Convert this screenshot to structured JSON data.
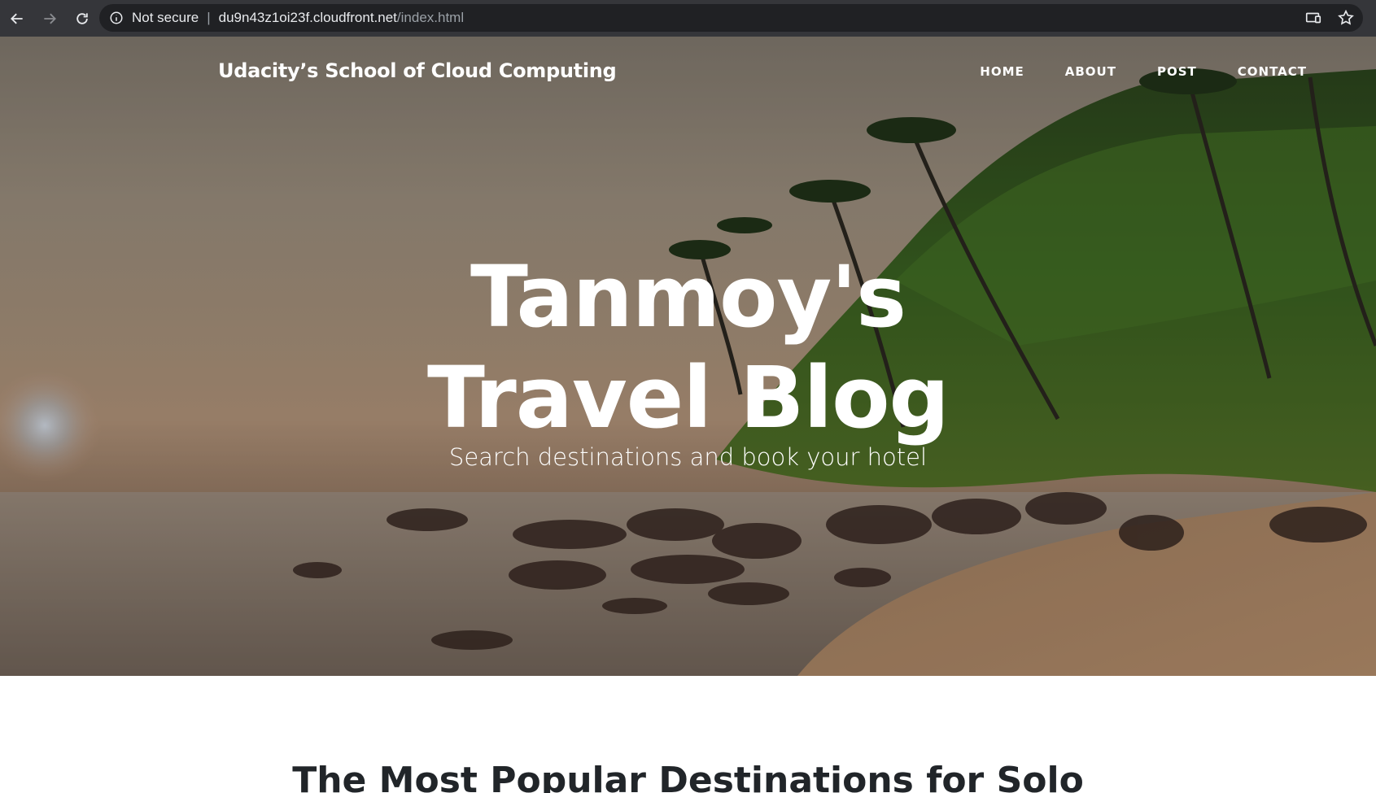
{
  "browser": {
    "security_label": "Not secure",
    "separator": "|",
    "url_host": "du9n43z1oi23f.cloudfront.net",
    "url_path": "/index.html",
    "icons": [
      "back-icon",
      "forward-icon",
      "reload-icon",
      "info-icon",
      "cast-icon",
      "star-icon"
    ]
  },
  "site": {
    "brand": "Udacity’s School of Cloud Computing",
    "nav": [
      {
        "label": "HOME"
      },
      {
        "label": "ABOUT"
      },
      {
        "label": "POST"
      },
      {
        "label": "CONTACT"
      }
    ]
  },
  "hero": {
    "title": "Tanmoy's Travel Blog",
    "subtitle": "Search destinations and book your hotel"
  },
  "content": {
    "first_post_heading": "The Most Popular Destinations for Solo"
  },
  "colors": {
    "chrome_bg": "#35363a",
    "omnibox_bg": "#202124",
    "hero_text": "#ffffff",
    "heading_text": "#212529"
  }
}
